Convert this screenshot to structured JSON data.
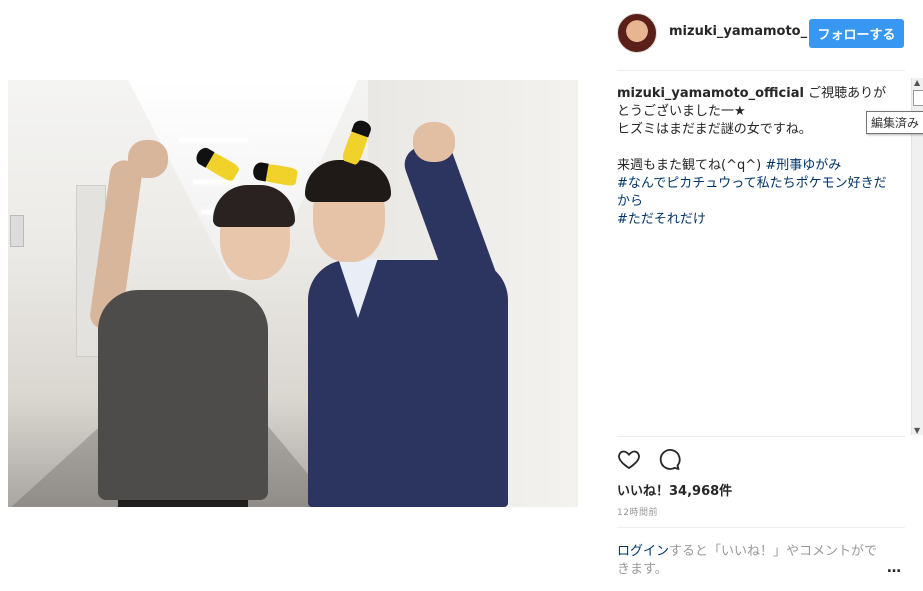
{
  "post": {
    "photo_alt": "",
    "header": {
      "username": "mizuki_yamamoto_",
      "follow_label": "フォローする"
    },
    "caption": {
      "username": "mizuki_yamamoto_official",
      "line1": " ご視聴ありがとうございました一★",
      "line2": "ヒズミはまだまだ謎の女ですね。",
      "line3_text": "来週もまた観てね(^q^) ",
      "tag1": "#刑事ゆがみ",
      "tag2": "#なんでピカチュウって私たちポケモン好きだから",
      "tag3": "#ただそれだけ"
    },
    "tooltip": "編集済み",
    "likes": "いいね！34,968件",
    "timestamp": "12時間前",
    "login": {
      "link": "ログイン",
      "rest": "すると「いいね！」やコメントができます。"
    },
    "more_label": "…",
    "icons": {
      "like": "heart-icon",
      "comment": "comment-icon",
      "more": "more-options-icon"
    },
    "colors": {
      "follow": "#3897f0",
      "hashtag": "#003569",
      "meta": "#999999"
    }
  }
}
